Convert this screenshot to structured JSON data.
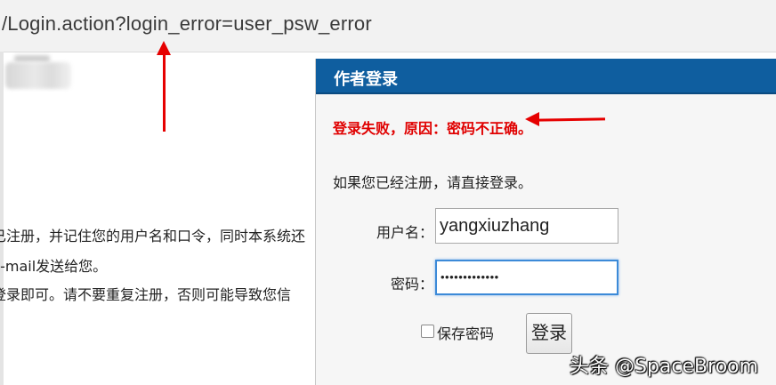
{
  "address_bar": {
    "url": "/Login.action?login_error=user_psw_error"
  },
  "notice": {
    "line1": "已注册，并记住您的用户名和口令，同时本系统还",
    "line2": "E-mail发送给您。",
    "line3": "登录即可。请不要重复注册，否则可能导致您信"
  },
  "login_panel": {
    "title": "作者登录",
    "error_message": "登录失败，原因：密码不正确。",
    "hint": "如果您已经注册，请直接登录。",
    "username_label": "用户名：",
    "username_value": "yangxiuzhang",
    "password_label": "密码：",
    "password_value": "•••••••••••••",
    "remember_label": "保存密码",
    "remember_checked": false,
    "login_button": "登录"
  },
  "watermark": {
    "text": "头条 @SpaceBroom"
  },
  "colors": {
    "header_blue": "#0f5e9f",
    "error_red": "#e00000",
    "annotation_arrow": "#e60000"
  }
}
